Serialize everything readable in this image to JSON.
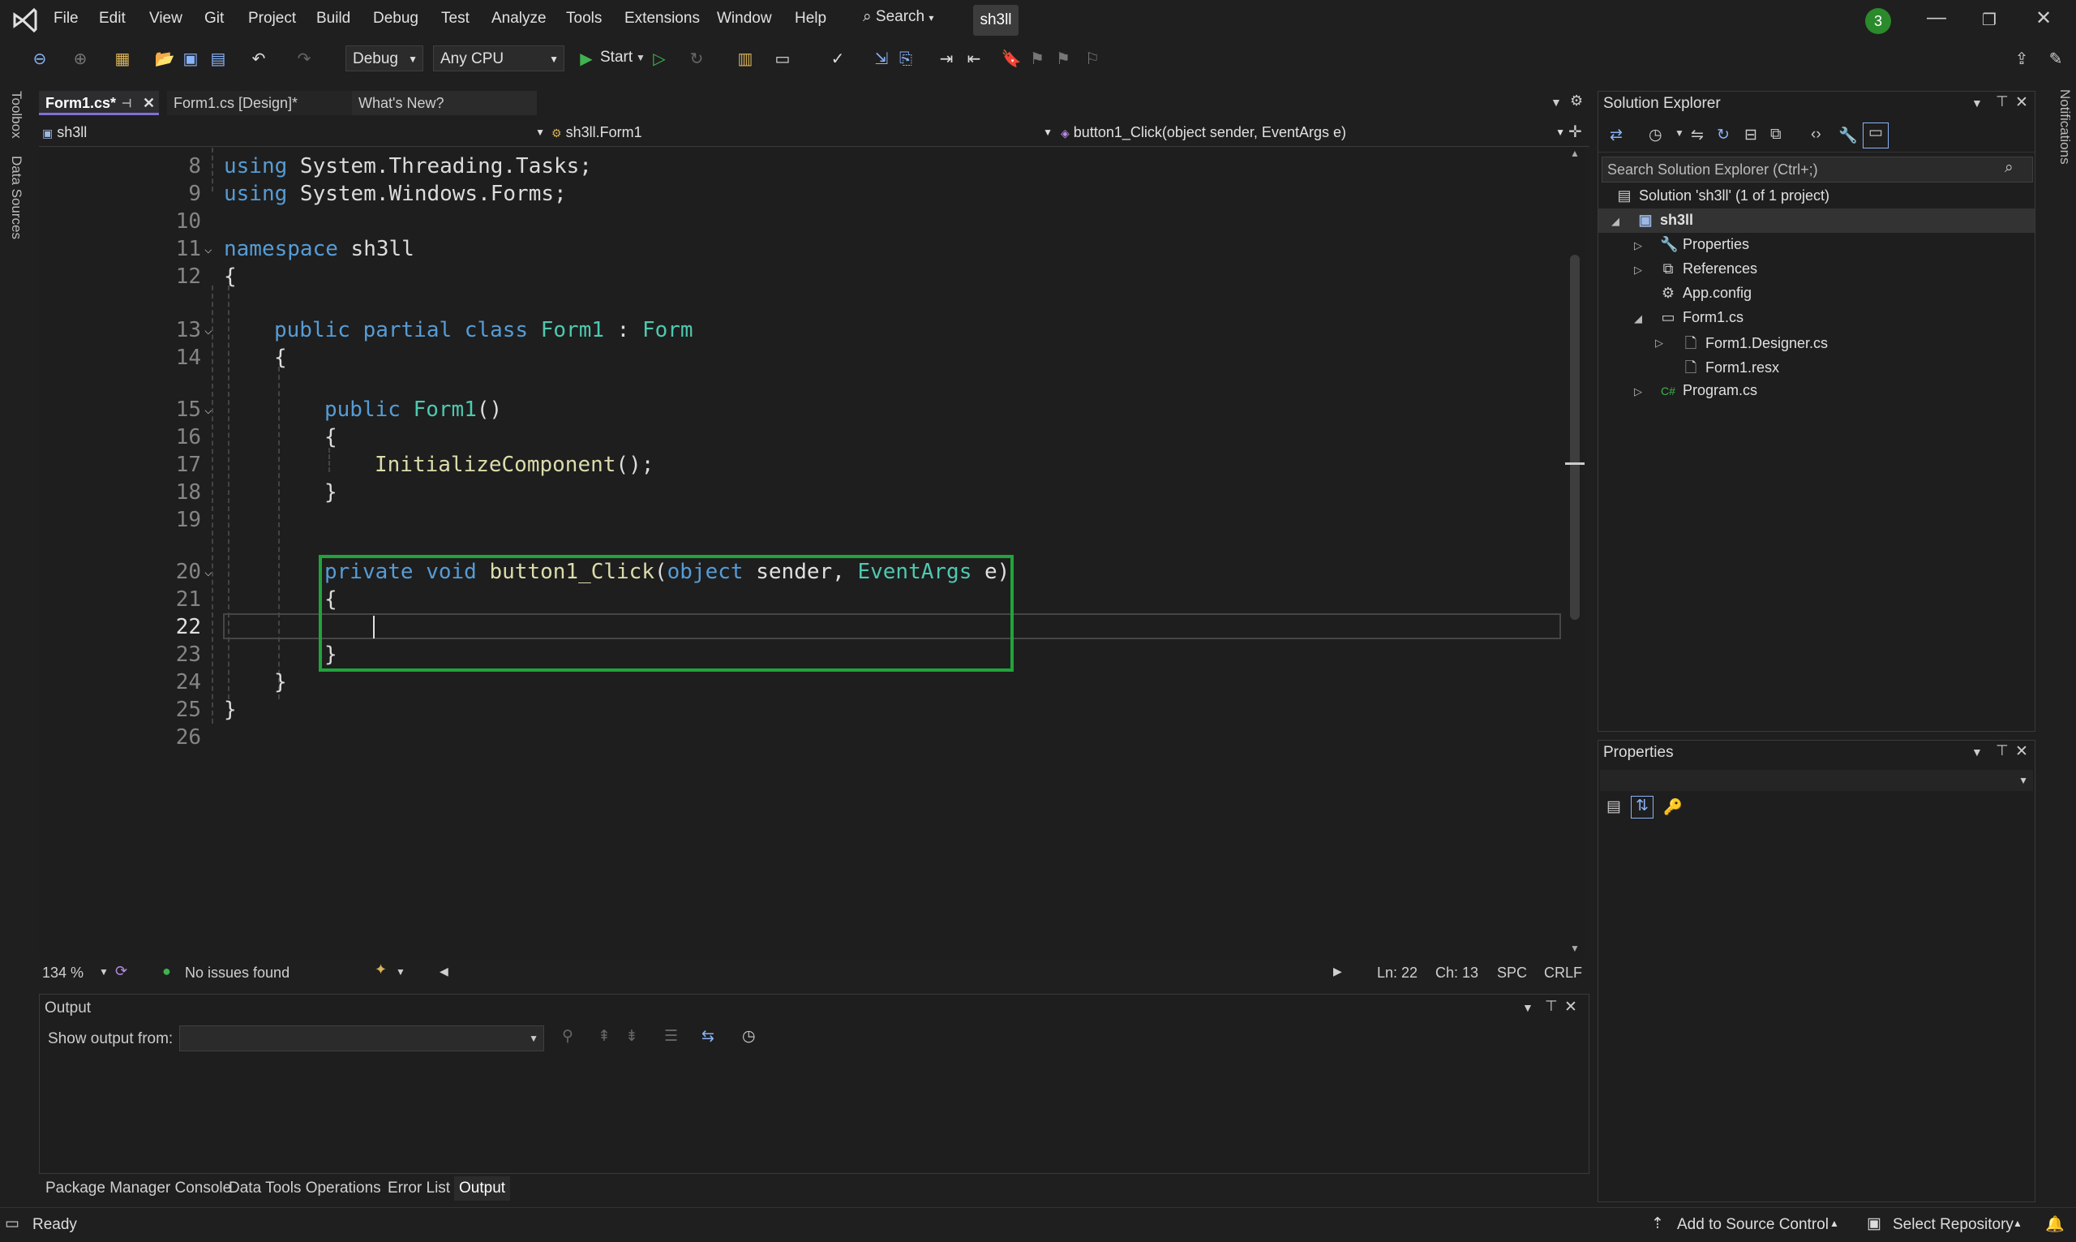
{
  "menu": [
    "File",
    "Edit",
    "View",
    "Git",
    "Project",
    "Build",
    "Debug",
    "Test",
    "Analyze",
    "Tools",
    "Extensions",
    "Window",
    "Help"
  ],
  "search_label": "Search",
  "solution_badge": "sh3ll",
  "notification_count": "3",
  "toolbar": {
    "config": "Debug",
    "platform": "Any CPU",
    "start_label": "Start"
  },
  "left_strip": {
    "toolbox": "Toolbox",
    "data_sources": "Data Sources"
  },
  "right_strip": {
    "notifications": "Notifications"
  },
  "editor_tabs": [
    "Form1.cs*",
    "Form1.cs [Design]*",
    "What's New?"
  ],
  "nav": {
    "project": "sh3ll",
    "type": "sh3ll.Form1",
    "member": "button1_Click(object sender, EventArgs e)"
  },
  "code": {
    "line_numbers": [
      "8",
      "9",
      "10",
      "11",
      "12",
      "13",
      "14",
      "15",
      "16",
      "17",
      "18",
      "19",
      "20",
      "21",
      "22",
      "23",
      "24",
      "25",
      "26"
    ],
    "l8_kw": "using",
    "l8_rest": " System.Threading.Tasks;",
    "l9_kw": "using",
    "l9_rest": " System.Windows.Forms;",
    "l11_kw": "namespace",
    "l11_rest": " sh3ll",
    "brace_open": "{",
    "brace_close": "}",
    "l13_kw": "public partial class",
    "l13_cls": " Form1",
    "l13_colon": " : ",
    "l13_base": "Form",
    "l15_kw": "public",
    "l15_ctor": " Form1",
    "l15_paren": "()",
    "l17_fn": "InitializeComponent",
    "l17_rest": "();",
    "l20_kw": "private void",
    "l20_fn": " button1_Click",
    "l20_p1": "(",
    "l20_obj": "object",
    "l20_sender": " sender, ",
    "l20_ea": "EventArgs",
    "l20_e": " e)"
  },
  "editor_status": {
    "zoom": "134 %",
    "issues": "No issues found",
    "ln": "Ln: 22",
    "ch": "Ch: 13",
    "spc": "SPC",
    "crlf": "CRLF"
  },
  "output": {
    "title": "Output",
    "show_from": "Show output from:"
  },
  "bottom_tabs": [
    "Package Manager Console",
    "Data Tools Operations",
    "Error List",
    "Output"
  ],
  "solution_explorer": {
    "title": "Solution Explorer",
    "search_placeholder": "Search Solution Explorer (Ctrl+;)",
    "solution": "Solution 'sh3ll' (1 of 1 project)",
    "project": "sh3ll",
    "items": [
      "Properties",
      "References",
      "App.config",
      "Form1.cs",
      "Form1.Designer.cs",
      "Form1.resx",
      "Program.cs"
    ]
  },
  "properties_panel": {
    "title": "Properties"
  },
  "statusbar": {
    "ready": "Ready",
    "source_control": "Add to Source Control",
    "repo": "Select Repository"
  },
  "colors": {
    "keyword": "#569cd6",
    "type": "#4ec9b0",
    "method": "#dcdcaa",
    "highlight": "#21a33b"
  }
}
